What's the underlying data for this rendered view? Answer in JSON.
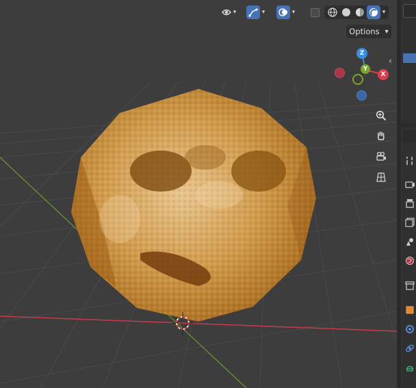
{
  "header": {
    "options_label": "Options",
    "options_caret": "⌄"
  },
  "gizmo": {
    "z_label": "Z",
    "y_label": "Y",
    "x_label": "X",
    "colors": {
      "x": "#e23c4f",
      "y": "#7aa52c",
      "z": "#3a8ee0",
      "neg_x": "#a83644",
      "neg_z": "#3a66a8",
      "neg_y": "#6a8a2c"
    }
  },
  "nav_buttons": [
    "zoom-icon",
    "pan-hand-icon",
    "camera-view-icon",
    "ortho-grid-icon"
  ],
  "colors": {
    "viewport_bg": "#3d3d3d",
    "grid_line": "#4a4a4a",
    "x_axis_line": "#c83a4c",
    "y_axis_line": "#6e9a2e",
    "active_blue": "#4772b3"
  }
}
